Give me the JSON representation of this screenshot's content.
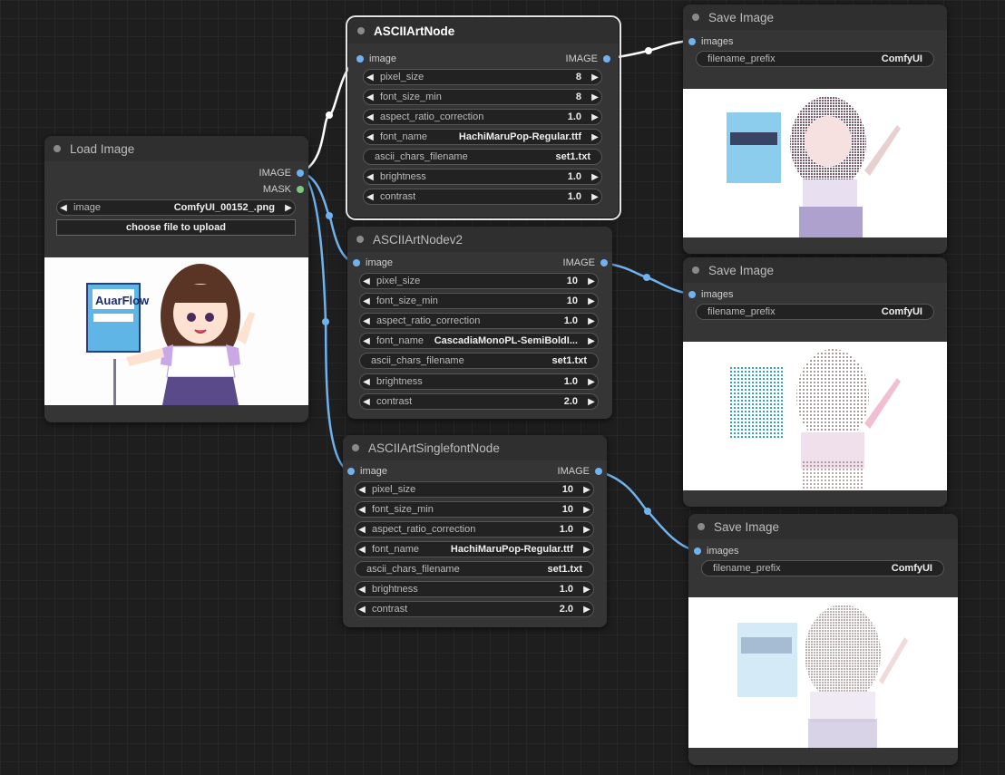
{
  "load_image": {
    "title": "Load Image",
    "out_image": "IMAGE",
    "out_mask": "MASK",
    "image_label": "image",
    "image_value": "ComfyUI_00152_.png",
    "upload_button": "choose file to upload",
    "sign_text": "AuarFlow"
  },
  "node1": {
    "title": "ASCIIArtNode",
    "in_label": "image",
    "out_label": "IMAGE",
    "widgets": [
      {
        "label": "pixel_size",
        "value": "8"
      },
      {
        "label": "font_size_min",
        "value": "8"
      },
      {
        "label": "aspect_ratio_correction",
        "value": "1.0"
      },
      {
        "label": "font_name",
        "value": "HachiMaruPop-Regular.ttf"
      },
      {
        "label": "ascii_chars_filename",
        "value": "set1.txt"
      },
      {
        "label": "brightness",
        "value": "1.0"
      },
      {
        "label": "contrast",
        "value": "1.0"
      }
    ]
  },
  "node2": {
    "title": "ASCIIArtNodev2",
    "in_label": "image",
    "out_label": "IMAGE",
    "widgets": [
      {
        "label": "pixel_size",
        "value": "10"
      },
      {
        "label": "font_size_min",
        "value": "10"
      },
      {
        "label": "aspect_ratio_correction",
        "value": "1.0"
      },
      {
        "label": "font_name",
        "value": "CascadiaMonoPL-SemiBoldI..."
      },
      {
        "label": "ascii_chars_filename",
        "value": "set1.txt"
      },
      {
        "label": "brightness",
        "value": "1.0"
      },
      {
        "label": "contrast",
        "value": "2.0"
      }
    ]
  },
  "node3": {
    "title": "ASCIIArtSinglefontNode",
    "in_label": "image",
    "out_label": "IMAGE",
    "widgets": [
      {
        "label": "pixel_size",
        "value": "10"
      },
      {
        "label": "font_size_min",
        "value": "10"
      },
      {
        "label": "aspect_ratio_correction",
        "value": "1.0"
      },
      {
        "label": "font_name",
        "value": "HachiMaruPop-Regular.ttf"
      },
      {
        "label": "ascii_chars_filename",
        "value": "set1.txt"
      },
      {
        "label": "brightness",
        "value": "1.0"
      },
      {
        "label": "contrast",
        "value": "2.0"
      }
    ]
  },
  "save1": {
    "title": "Save Image",
    "in_label": "images",
    "prefix_label": "filename_prefix",
    "prefix_value": "ComfyUI"
  },
  "save2": {
    "title": "Save Image",
    "in_label": "images",
    "prefix_label": "filename_prefix",
    "prefix_value": "ComfyUI"
  },
  "save3": {
    "title": "Save Image",
    "in_label": "images",
    "prefix_label": "filename_prefix",
    "prefix_value": "ComfyUI"
  },
  "colors": {
    "wire": "#6fb2ee",
    "selected_wire": "#ffffff",
    "mask": "#7ec87e",
    "canvas": "#1e1e1e",
    "node": "#353535"
  }
}
